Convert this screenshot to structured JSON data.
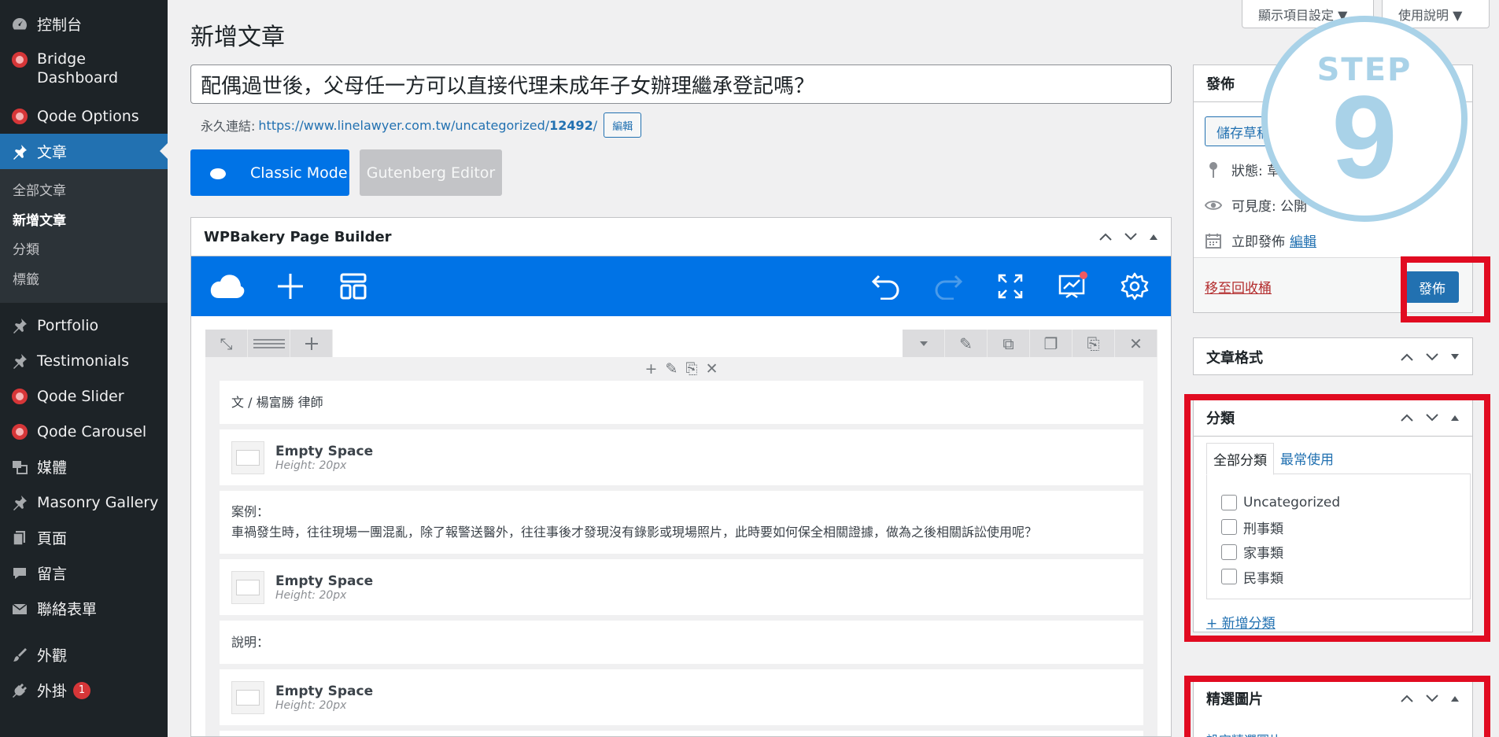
{
  "sidebar": {
    "items": [
      {
        "label": "控制台",
        "icon": "dashboard-icon"
      },
      {
        "label": "Bridge Dashboard",
        "icon": "bridge-icon"
      },
      {
        "label": "Qode Options",
        "icon": "qode-icon"
      },
      {
        "label": "文章",
        "icon": "pin-icon"
      },
      {
        "label": "Portfolio",
        "icon": "pin-icon"
      },
      {
        "label": "Testimonials",
        "icon": "pin-icon"
      },
      {
        "label": "Qode Slider",
        "icon": "qode-icon"
      },
      {
        "label": "Qode Carousel",
        "icon": "qode-icon"
      },
      {
        "label": "媒體",
        "icon": "media-icon"
      },
      {
        "label": "Masonry Gallery",
        "icon": "pin-icon"
      },
      {
        "label": "頁面",
        "icon": "page-icon"
      },
      {
        "label": "留言",
        "icon": "comment-icon"
      },
      {
        "label": "聯絡表單",
        "icon": "mail-icon"
      },
      {
        "label": "外觀",
        "icon": "brush-icon"
      },
      {
        "label": "外掛",
        "icon": "plugin-icon",
        "badge": "1"
      }
    ],
    "submenu": [
      "全部文章",
      "新增文章",
      "分類",
      "標籤"
    ]
  },
  "topbar": {
    "screen_options": "顯示項目設定 ▼",
    "help": "使用說明 ▼"
  },
  "page": {
    "title": "新增文章",
    "post_title": "配偶過世後，父母任一方可以直接代理未成年子女辦理繼承登記嗎？",
    "permalink_label": "永久連結:",
    "permalink_url_base": "https://www.linelawyer.com.tw/uncategorized/",
    "permalink_url_id": "12492",
    "permalink_url_end": "/",
    "edit_label": "編輯"
  },
  "editor_mode": {
    "classic": "Classic Mode",
    "gutenberg": "Gutenberg Editor"
  },
  "wpbakery": {
    "title": "WPBakery Page Builder",
    "elements": {
      "author": "文 / 楊富勝 律師",
      "space1_name": "Empty Space",
      "space1_height": "Height: 20px",
      "case_label": "案例：",
      "case_text": "車禍發生時，往往現場一團混亂，除了報警送醫外，往往事後才發現沒有錄影或現場照片，此時要如何保全相關證據，做為之後相關訴訟使用呢？",
      "space2_name": "Empty Space",
      "space2_height": "Height: 20px",
      "explain_label": "說明：",
      "space3_name": "Empty Space",
      "space3_height": "Height: 20px"
    }
  },
  "publish": {
    "title": "發佈",
    "save_draft": "儲存草稿",
    "status": "狀態: 草",
    "visibility": "可見度: 公開",
    "publish_now": "立即發佈",
    "edit": "編輯",
    "trash": "移至回收桶",
    "publish_btn": "發佈"
  },
  "format": {
    "title": "文章格式"
  },
  "category": {
    "title": "分類",
    "tab_all": "全部分類",
    "tab_popular": "最常使用",
    "items": [
      "Uncategorized",
      "刑事類",
      "家事類",
      "民事類"
    ],
    "add_new": "+ 新增分類"
  },
  "featured": {
    "title": "精選圖片",
    "set_link": "設定精選圖片"
  },
  "step": {
    "label": "STEP",
    "number": "9"
  },
  "colors": {
    "accent": "#2271b1",
    "builder_blue": "#0073e6",
    "highlight_red": "#e10b21",
    "step_blue": "#a9d2e8"
  }
}
